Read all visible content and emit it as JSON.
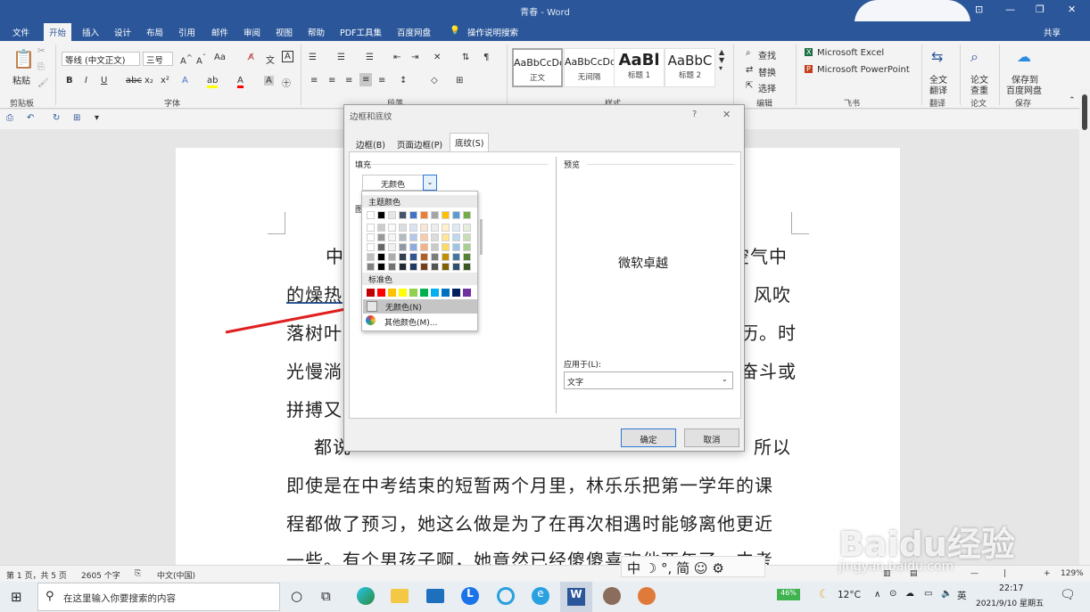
{
  "window": {
    "title": "青春 - Word"
  },
  "tabs": [
    "文件",
    "开始",
    "插入",
    "设计",
    "布局",
    "引用",
    "邮件",
    "审阅",
    "视图",
    "帮助",
    "PDF工具集",
    "百度网盘",
    "操作说明搜索",
    "共享"
  ],
  "ribbon": {
    "clipboard": {
      "paste": "粘贴",
      "group": "剪贴板"
    },
    "font": {
      "name": "等线 (中文正文)",
      "size": "三号",
      "group": "字体"
    },
    "paragraph": {
      "group": "段落"
    },
    "styles": {
      "group": "样式",
      "items": [
        {
          "preview": "AaBbCcDd",
          "name": "正文"
        },
        {
          "preview": "AaBbCcDd",
          "name": "无间隔"
        },
        {
          "preview": "AaBl",
          "name": "标题 1"
        },
        {
          "preview": "AaBbC",
          "name": "标题 2"
        }
      ]
    },
    "editing": {
      "find": "查找",
      "replace": "替换",
      "select": "选择",
      "group": "编辑"
    },
    "feishu": {
      "excel": "Microsoft Excel",
      "ppt": "Microsoft PowerPoint",
      "group": "飞书"
    },
    "translate": {
      "btn1": "全文",
      "btn2": "翻译",
      "group": "翻译"
    },
    "paper": {
      "btn1": "论文",
      "btn2": "查重",
      "group": "论文"
    },
    "save": {
      "btn1": "保存到",
      "btn2": "百度网盘",
      "group": "保存"
    }
  },
  "document": {
    "lines": [
      "中",
      "空气中",
      "的燥热",
      "风吹",
      "落树叶",
      "历。时",
      "光慢淌",
      "奋斗或",
      "拼搏又",
      "都说",
      "所以",
      "即使是在中考结束的短暂两个月里，林乐乐把第一学年的课",
      "程都做了预习，她这么做是为了在再次相遇时能够离他更近",
      "一些。有个男孩子啊，她竟然已经傻傻喜欢他两年了。中考"
    ]
  },
  "dialog": {
    "title": "边框和底纹",
    "help": "?",
    "close": "✕",
    "tabs": [
      "边框(B)",
      "页面边框(P)",
      "底纹(S)"
    ],
    "fill_label": "填充",
    "fill_value": "无颜色",
    "pattern_label": "图",
    "preview_label": "预览",
    "preview_text": "微软卓越",
    "apply_label": "应用于(L):",
    "apply_value": "文字",
    "ok": "确定",
    "cancel": "取消"
  },
  "color_dropdown": {
    "theme_label": "主题颜色",
    "standard_label": "标准色",
    "no_color": "无颜色(N)",
    "more_colors": "其他颜色(M)...",
    "theme_colors": [
      "#ffffff",
      "#000000",
      "#e7e6e6",
      "#44546a",
      "#4472c4",
      "#ed7d31",
      "#a5a5a5",
      "#ffc000",
      "#5b9bd5",
      "#70ad47"
    ],
    "standard_colors": [
      "#c00000",
      "#ff0000",
      "#ffc000",
      "#ffff00",
      "#92d050",
      "#00b050",
      "#00b0f0",
      "#0070c0",
      "#002060",
      "#7030a0"
    ]
  },
  "status": {
    "page": "第 1 页，共 5 页",
    "words": "2605 个字",
    "lang": "中文(中国)",
    "zoom": "129%"
  },
  "ime": {
    "mode": "中",
    "punct": "°,",
    "simp": "简"
  },
  "taskbar": {
    "search": "在这里输入你要搜索的内容",
    "battery": "46%",
    "temp": "12°C",
    "lang": "英",
    "time": "22:17",
    "date": "2021/9/10 星期五"
  },
  "watermark": {
    "main": "Baidu经验",
    "sub": "jingyan.baidu.com"
  }
}
